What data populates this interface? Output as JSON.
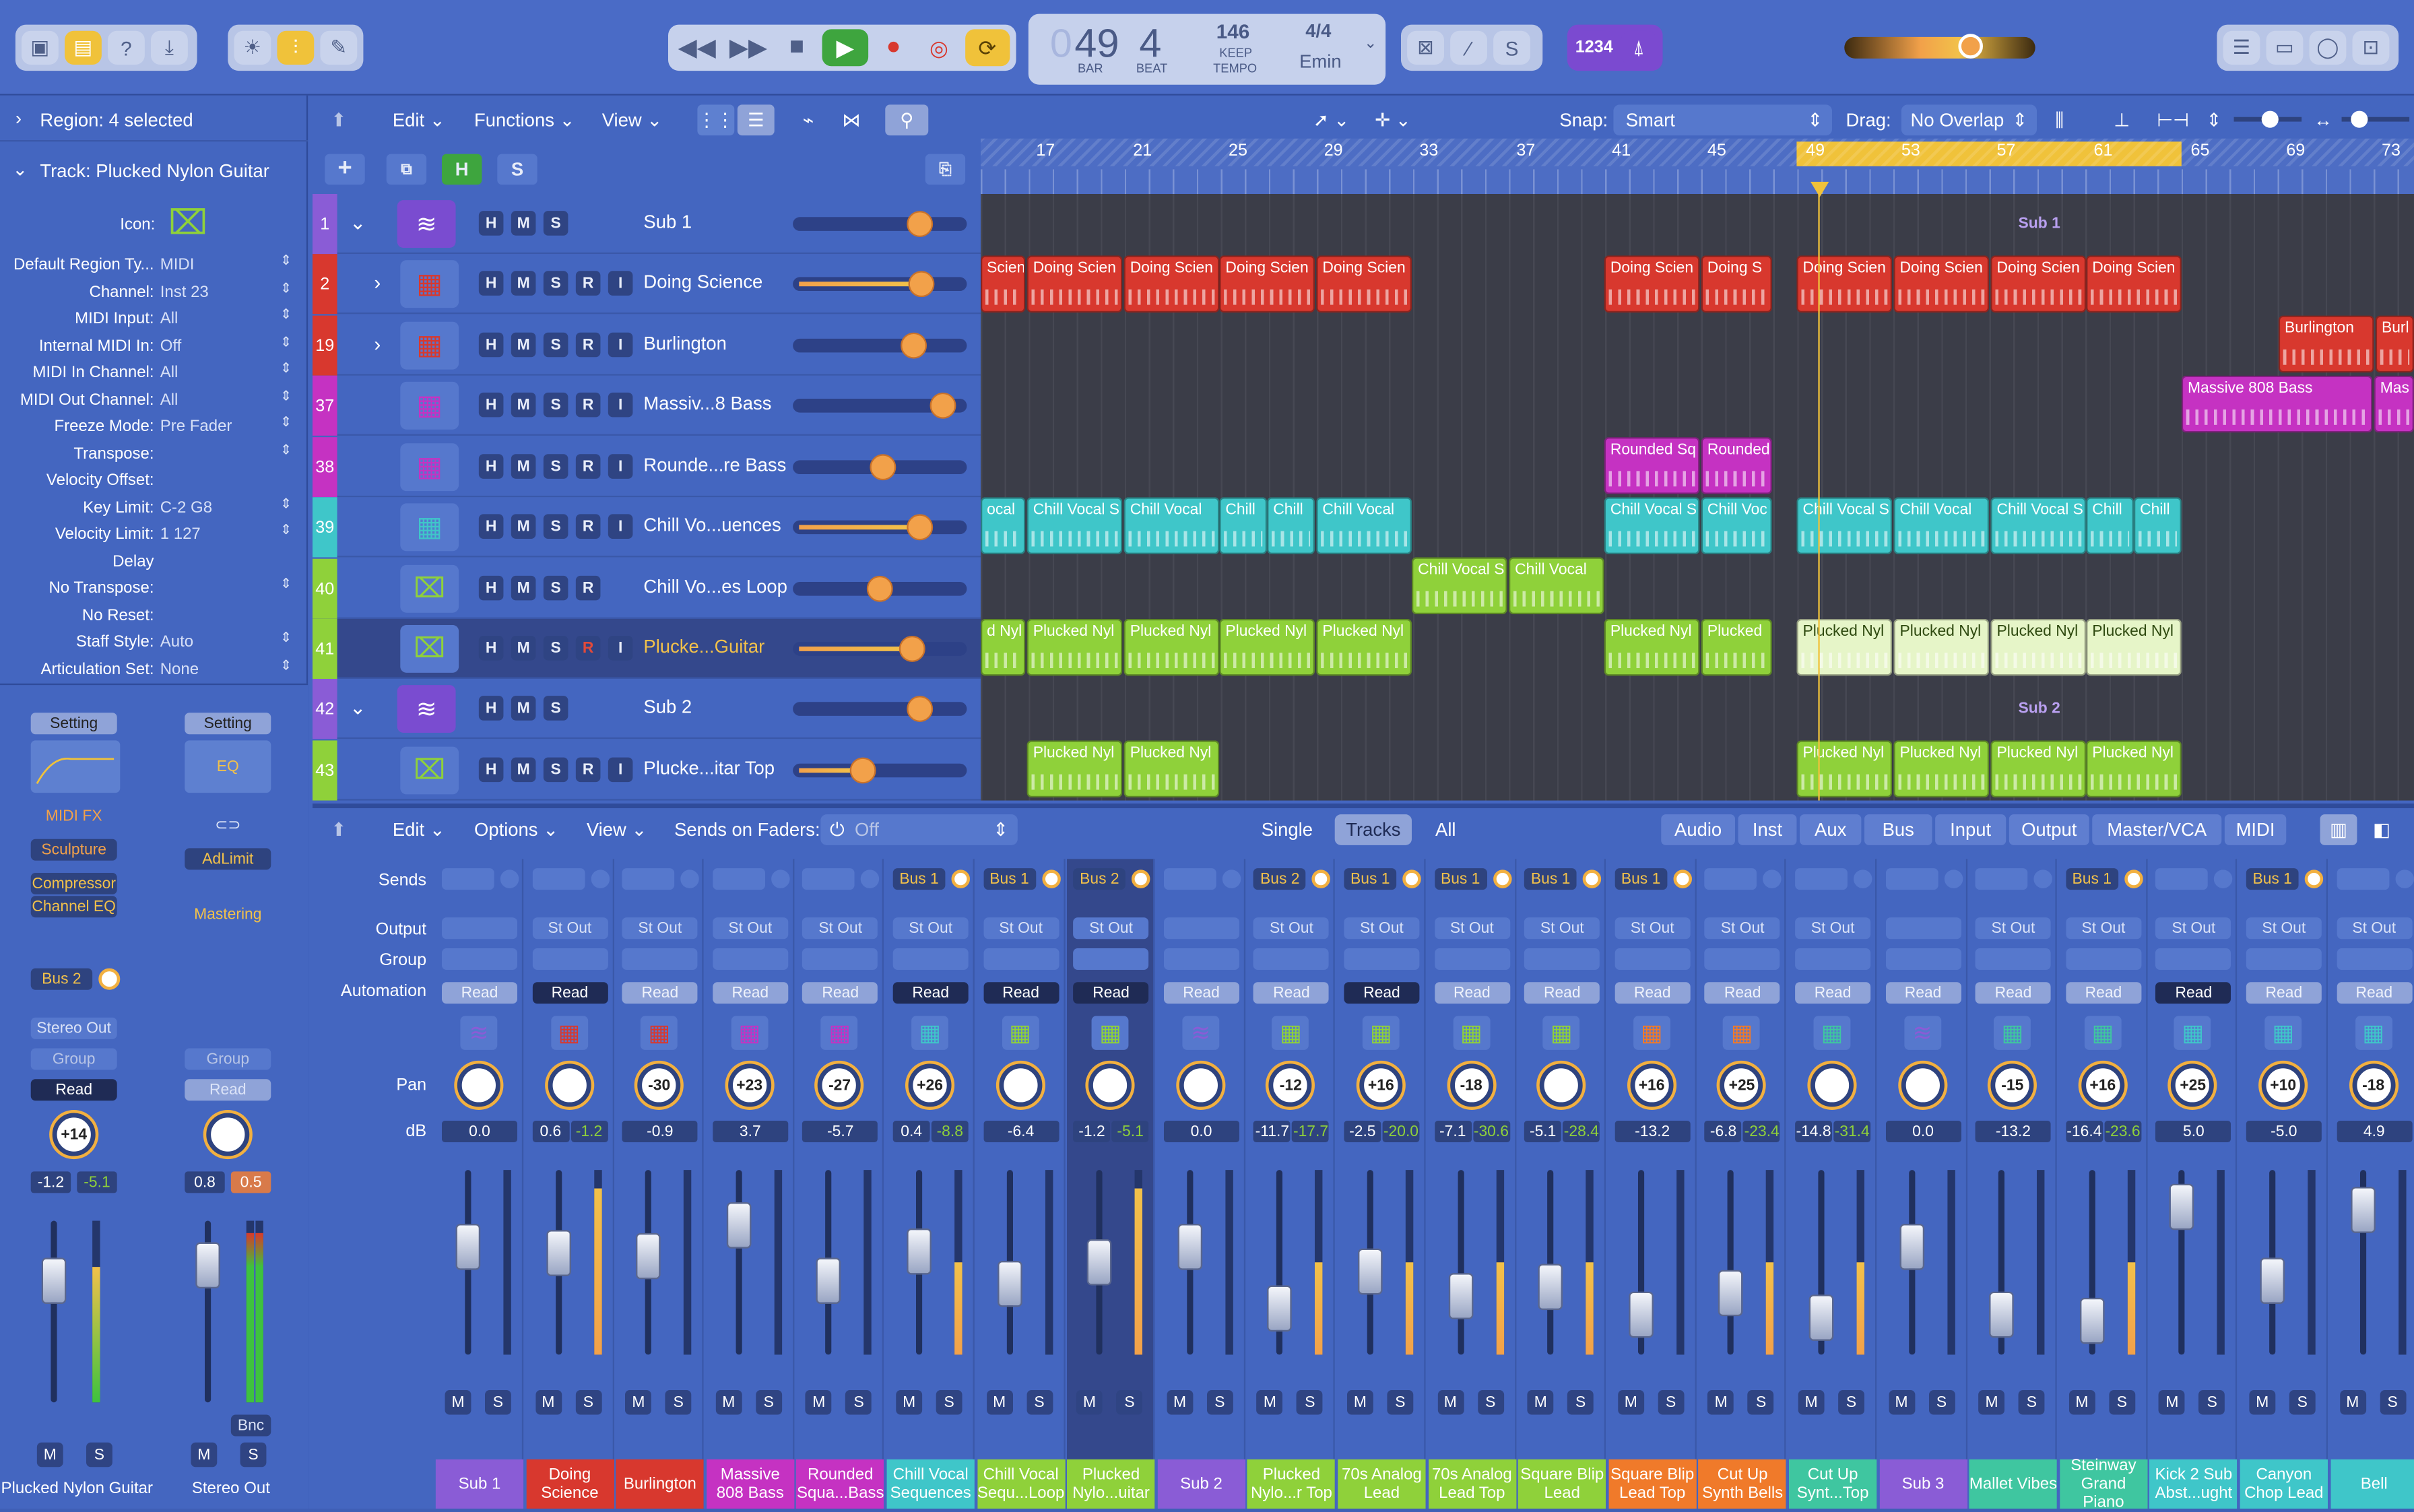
{
  "control_bar": {
    "lcd": {
      "bar": "49",
      "beat": "4",
      "bar_label": "BAR",
      "beat_label": "BEAT",
      "tempo": "146",
      "keep": "KEEP",
      "tempo_label": "TEMPO",
      "signature": "4/4",
      "key": "Emin",
      "prefix": "0"
    },
    "counter_label": "1234"
  },
  "inspector": {
    "region_header": "Region: 4 selected",
    "track_header": "Track: Plucked Nylon Guitar",
    "icon_label": "Icon:",
    "params": [
      {
        "label": "Default Region Ty...",
        "value": "MIDI"
      },
      {
        "label": "Channel:",
        "value": "Inst 23"
      },
      {
        "label": "MIDI Input:",
        "value": "All"
      },
      {
        "label": "Internal MIDI In:",
        "value": "Off"
      },
      {
        "label": "MIDI In Channel:",
        "value": "All"
      },
      {
        "label": "MIDI Out Channel:",
        "value": "All"
      },
      {
        "label": "Freeze Mode:",
        "value": "Pre Fader"
      },
      {
        "label": "Transpose:",
        "value": ""
      },
      {
        "label": "Velocity Offset:",
        "value": ""
      },
      {
        "label": "Key Limit:",
        "value": "C-2  G8"
      },
      {
        "label": "Velocity Limit:",
        "value": "1  127"
      },
      {
        "label": "Delay",
        "value": ""
      },
      {
        "label": "No Transpose:",
        "value": ""
      },
      {
        "label": "No Reset:",
        "value": ""
      },
      {
        "label": "Staff Style:",
        "value": "Auto"
      },
      {
        "label": "Articulation Set:",
        "value": "None"
      }
    ],
    "strip_left": {
      "setting": "Setting",
      "midi_fx": "MIDI FX",
      "sculpture": "Sculpture",
      "compressor": "Compressor",
      "channel_eq": "Channel EQ",
      "bus": "Bus 2",
      "output": "Stereo Out",
      "group": "Group",
      "automation": "Read",
      "pan": "+14",
      "db1": "-1.2",
      "db2": "-5.1",
      "m": "M",
      "s": "S",
      "name": "Plucked Nylon Guitar"
    },
    "strip_right": {
      "setting": "Setting",
      "eq": "EQ",
      "adlimit": "AdLimit",
      "mastering": "Mastering",
      "group": "Group",
      "automation": "Read",
      "db1": "0.8",
      "db2": "0.5",
      "bnc": "Bnc",
      "m": "M",
      "s": "S",
      "name": "Stereo Out"
    }
  },
  "tracks_menu": {
    "edit": "Edit",
    "functions": "Functions",
    "view": "View",
    "snap_label": "Snap:",
    "snap_value": "Smart",
    "drag_label": "Drag:",
    "drag_value": "No Overlap",
    "h": "H",
    "s": "S"
  },
  "ruler": [
    "17",
    "21",
    "25",
    "29",
    "33",
    "37",
    "41",
    "45",
    "49",
    "53",
    "57",
    "61",
    "65",
    "69",
    "73"
  ],
  "tracks": [
    {
      "num": "1",
      "name": "Sub 1",
      "color": "#8a5cd6",
      "type": "folder"
    },
    {
      "num": "2",
      "name": "Doing Science",
      "color": "#d8382e",
      "type": "inst"
    },
    {
      "num": "19",
      "name": "Burlington",
      "color": "#d8382e",
      "type": "inst"
    },
    {
      "num": "37",
      "name": "Massiv...8 Bass",
      "color": "#c532c2",
      "type": "inst"
    },
    {
      "num": "38",
      "name": "Rounde...re Bass",
      "color": "#c532c2",
      "type": "inst"
    },
    {
      "num": "39",
      "name": "Chill Vo...uences",
      "color": "#3fc6c9",
      "type": "inst"
    },
    {
      "num": "40",
      "name": "Chill Vo...es Loop",
      "color": "#8fd13a",
      "type": "inst"
    },
    {
      "num": "41",
      "name": "Plucke...Guitar",
      "color": "#8fd13a",
      "type": "inst"
    },
    {
      "num": "42",
      "name": "Sub 2",
      "color": "#8a5cd6",
      "type": "folder"
    },
    {
      "num": "43",
      "name": "Plucke...itar Top",
      "color": "#8fd13a",
      "type": "inst"
    }
  ],
  "regions": {
    "sub1": "Sub 1",
    "sub2": "Sub 2",
    "doing": "Doing Scien",
    "doing_short": "Doing S",
    "scien": "Scien",
    "burlington": "Burlington",
    "burl": "Burl",
    "massive": "Massive 808 Bass",
    "mas": "Mas",
    "rounded_sq": "Rounded Sq",
    "rounded": "Rounded",
    "chill_vocal_s": "Chill Vocal S",
    "chill_vocal": "Chill Vocal",
    "chill": "Chill",
    "chill_voc": "Chill Voc",
    "ocal": "ocal",
    "plucked_nyl": "Plucked Nyl",
    "plucked": "Plucked",
    "d_nyl": "d Nyl"
  },
  "mixer_menu": {
    "edit": "Edit",
    "options": "Options",
    "view": "View",
    "sends_on_faders": "Sends on Faders:",
    "off": "Off",
    "single": "Single",
    "tracks": "Tracks",
    "all": "All",
    "filters": [
      "Audio",
      "Inst",
      "Aux",
      "Bus",
      "Input",
      "Output",
      "Master/VCA",
      "MIDI"
    ]
  },
  "mixer_labels": {
    "sends": "Sends",
    "output": "Output",
    "group": "Group",
    "automation": "Automation",
    "pan": "Pan",
    "db": "dB"
  },
  "strips": [
    {
      "name": "Sub 1",
      "color": "#8a5cd6",
      "bus": "",
      "out": "",
      "read": "Read",
      "dark": false,
      "pan": "",
      "db1": "0.0",
      "db2": "",
      "fpos": 0.42
    },
    {
      "name": "Doing Science",
      "color": "#d8382e",
      "bus": "",
      "out": "St Out",
      "read": "Read",
      "dark": true,
      "pan": "",
      "db1": "0.6",
      "db2": "-1.2",
      "fpos": 0.45
    },
    {
      "name": "Burlington",
      "color": "#d8382e",
      "bus": "",
      "out": "St Out",
      "read": "Read",
      "dark": false,
      "pan": "-30",
      "db1": "-0.9",
      "db2": "",
      "fpos": 0.47
    },
    {
      "name": "Massive 808 Bass",
      "color": "#c532c2",
      "bus": "",
      "out": "St Out",
      "read": "Read",
      "dark": false,
      "pan": "+23",
      "db1": "3.7",
      "db2": "",
      "fpos": 0.3
    },
    {
      "name": "Rounded Squa...Bass",
      "color": "#c532c2",
      "bus": "",
      "out": "St Out",
      "read": "Read",
      "dark": false,
      "pan": "-27",
      "db1": "-5.7",
      "db2": "",
      "fpos": 0.6
    },
    {
      "name": "Chill Vocal Sequences",
      "color": "#3fc6c9",
      "bus": "Bus 1",
      "out": "St Out",
      "read": "Read",
      "dark": true,
      "pan": "+26",
      "db1": "0.4",
      "db2": "-8.8",
      "fpos": 0.44
    },
    {
      "name": "Chill Vocal Sequ...Loop",
      "color": "#8fd13a",
      "bus": "Bus 1",
      "out": "St Out",
      "read": "Read",
      "dark": true,
      "pan": "",
      "db1": "-6.4",
      "db2": "",
      "fpos": 0.62
    },
    {
      "name": "Plucked Nylo...uitar",
      "color": "#8fd13a",
      "bus": "Bus 2",
      "out": "St Out",
      "read": "Read",
      "dark": true,
      "pan": "",
      "db1": "-1.2",
      "db2": "-5.1",
      "fpos": 0.5
    },
    {
      "name": "Sub 2",
      "color": "#8a5cd6",
      "bus": "",
      "out": "",
      "read": "Read",
      "dark": false,
      "pan": "",
      "db1": "0.0",
      "db2": "",
      "fpos": 0.42
    },
    {
      "name": "Plucked Nylo...r Top",
      "color": "#8fd13a",
      "bus": "Bus 2",
      "out": "St Out",
      "read": "Read",
      "dark": false,
      "pan": "-12",
      "db1": "-11.7",
      "db2": "-17.7",
      "fpos": 0.75
    },
    {
      "name": "70s Analog Lead",
      "color": "#8fd13a",
      "bus": "Bus 1",
      "out": "St Out",
      "read": "Read",
      "dark": true,
      "pan": "+16",
      "db1": "-2.5",
      "db2": "-20.0",
      "fpos": 0.55
    },
    {
      "name": "70s Analog Lead Top",
      "color": "#8fd13a",
      "bus": "Bus 1",
      "out": "St Out",
      "read": "Read",
      "dark": false,
      "pan": "-18",
      "db1": "-7.1",
      "db2": "-30.6",
      "fpos": 0.68
    },
    {
      "name": "Square Blip Lead",
      "color": "#8fd13a",
      "bus": "Bus 1",
      "out": "St Out",
      "read": "Read",
      "dark": false,
      "pan": "",
      "db1": "-5.1",
      "db2": "-28.4",
      "fpos": 0.63
    },
    {
      "name": "Square Blip Lead Top",
      "color": "#f07a2a",
      "bus": "Bus 1",
      "out": "St Out",
      "read": "Read",
      "dark": false,
      "pan": "+16",
      "db1": "-13.2",
      "db2": "",
      "fpos": 0.78
    },
    {
      "name": "Cut Up Synth Bells",
      "color": "#f07a2a",
      "bus": "",
      "out": "St Out",
      "read": "Read",
      "dark": false,
      "pan": "+25",
      "db1": "-6.8",
      "db2": "-23.4",
      "fpos": 0.67
    },
    {
      "name": "Cut Up Synt...Top",
      "color": "#3fc6a0",
      "bus": "",
      "out": "St Out",
      "read": "Read",
      "dark": false,
      "pan": "",
      "db1": "-14.8",
      "db2": "-31.4",
      "fpos": 0.8
    },
    {
      "name": "Sub 3",
      "color": "#8a5cd6",
      "bus": "",
      "out": "",
      "read": "Read",
      "dark": false,
      "pan": "",
      "db1": "0.0",
      "db2": "",
      "fpos": 0.42
    },
    {
      "name": "Mallet Vibes",
      "color": "#3fc6a0",
      "bus": "",
      "out": "St Out",
      "read": "Read",
      "dark": false,
      "pan": "-15",
      "db1": "-13.2",
      "db2": "",
      "fpos": 0.78
    },
    {
      "name": "Steinway Grand Piano",
      "color": "#3fc6a0",
      "bus": "Bus 1",
      "out": "St Out",
      "read": "Read",
      "dark": false,
      "pan": "+16",
      "db1": "-16.4",
      "db2": "-23.6",
      "fpos": 0.82
    },
    {
      "name": "Kick 2 Sub Abst...ught",
      "color": "#3fc6c9",
      "bus": "",
      "out": "St Out",
      "read": "Read",
      "dark": true,
      "pan": "+25",
      "db1": "5.0",
      "db2": "",
      "fpos": 0.2
    },
    {
      "name": "Canyon Chop Lead",
      "color": "#3fc6c9",
      "bus": "Bus 1",
      "out": "St Out",
      "read": "Read",
      "dark": false,
      "pan": "+10",
      "db1": "-5.0",
      "db2": "",
      "fpos": 0.6
    },
    {
      "name": "Bell",
      "color": "#3fc6c9",
      "bus": "",
      "out": "St Out",
      "read": "Read",
      "dark": false,
      "pan": "-18",
      "db1": "4.9",
      "db2": "",
      "fpos": 0.22
    }
  ],
  "ms_labels": {
    "m": "M",
    "s": "S",
    "r": "R",
    "i": "I"
  }
}
